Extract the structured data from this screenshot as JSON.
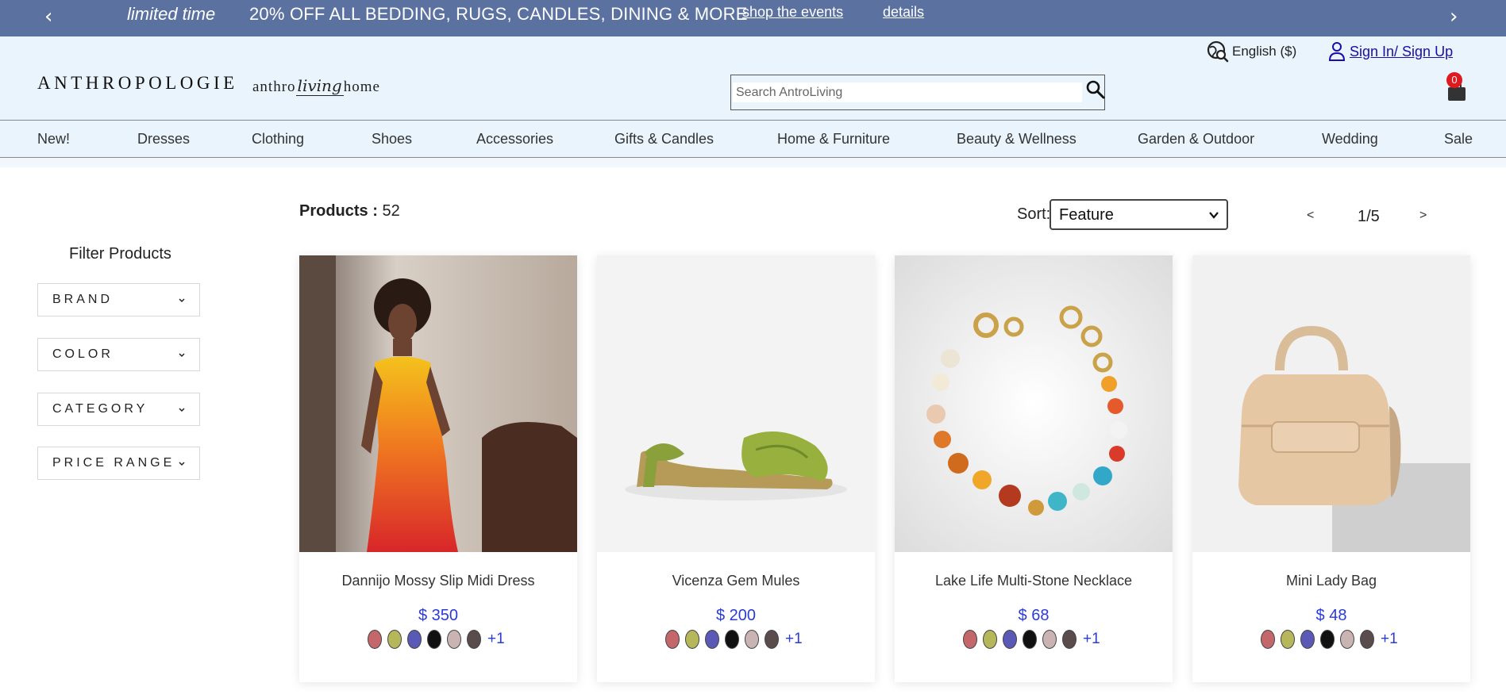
{
  "promo": {
    "tag": "limited time",
    "message": "20% OFF ALL BEDDING, RUGS, CANDLES, DINING & MORE",
    "link_events": "shop the events",
    "link_details": "details",
    "prev_icon": "chevron-left-icon",
    "next_icon": "chevron-right-icon"
  },
  "header": {
    "logo_main": "ANTHROPOLOGIE",
    "logo_sub_left": "anthro",
    "logo_sub_script": "living",
    "logo_sub_right": "home",
    "search_placeholder": "Search AntroLiving",
    "language": "English ($)",
    "signin": "Sign In/ Sign Up",
    "cart_count": "0"
  },
  "nav": {
    "items": [
      "New!",
      "Dresses",
      "Clothing",
      "Shoes",
      "Accessories",
      "Gifts & Candles",
      "Home & Furniture",
      "Beauty & Wellness",
      "Garden & Outdoor",
      "Wedding",
      "Sale"
    ]
  },
  "sidebar": {
    "title": "Filter Products",
    "filters": [
      "BRAND",
      "COLOR",
      "CATEGORY",
      "PRICE RANGE"
    ]
  },
  "listing": {
    "products_label": "Products :",
    "products_count": "52",
    "sort_label": "Sort:",
    "sort_value": "Feature",
    "pager_prev": "<",
    "pager_page": "1/5",
    "pager_next": ">"
  },
  "swatch_colors": [
    "#c4676a",
    "#b6b65a",
    "#5a5ab6",
    "#111111",
    "#c9b3b3",
    "#5a4c4c"
  ],
  "products": [
    {
      "name": "Dannijo Mossy Slip Midi Dress",
      "price": "$ 350",
      "more": "+1"
    },
    {
      "name": "Vicenza Gem Mules",
      "price": "$ 200",
      "more": "+1"
    },
    {
      "name": "Lake Life Multi-Stone Necklace",
      "price": "$ 68",
      "more": "+1"
    },
    {
      "name": "Mini Lady Bag",
      "price": "$ 48",
      "more": "+1"
    }
  ]
}
